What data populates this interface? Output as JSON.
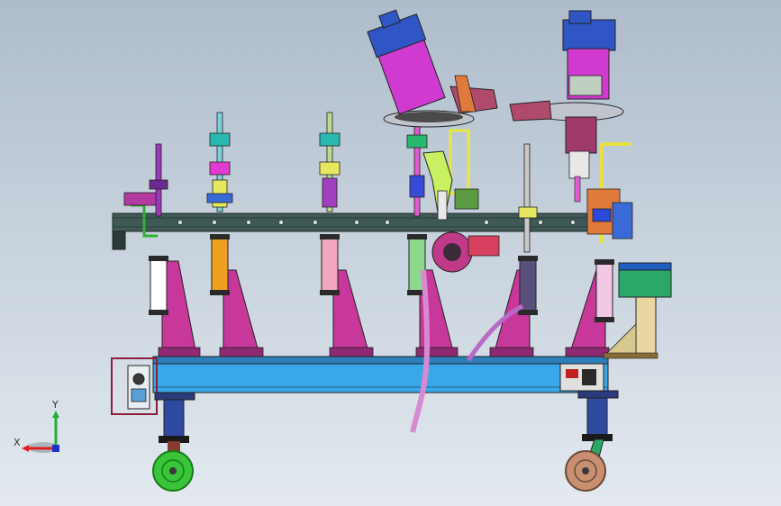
{
  "viewport": {
    "background_top": "#aebccb",
    "background_bottom": "#e3e9ef"
  },
  "triad": {
    "x_label": "X",
    "y_label": "Y",
    "x_color": "#e02020",
    "y_color": "#20b030",
    "z_color": "#2030d0"
  },
  "colors": {
    "outline": "#222222",
    "beam": "#3f5a56",
    "base_frame": "#3aa7e8",
    "gusset": "#c8379a",
    "robot_body": "#d03ad0",
    "robot_cap": "#2f56c4",
    "column": "#2e4aa0",
    "wheel_left": "#3ac43a",
    "wheel_right": "#c89070",
    "cabinet": "#2aa868",
    "cabinet_top": "#1f5fbf",
    "panel_tan": "#e8d7a0"
  },
  "cylinders": [
    {
      "color": "#ffffff"
    },
    {
      "color": "#f0a020"
    },
    {
      "color": "#f2a6bf"
    },
    {
      "color": "#8ed88e"
    },
    {
      "color": "#5a4f7a"
    },
    {
      "color": "#f1c9e4"
    }
  ]
}
